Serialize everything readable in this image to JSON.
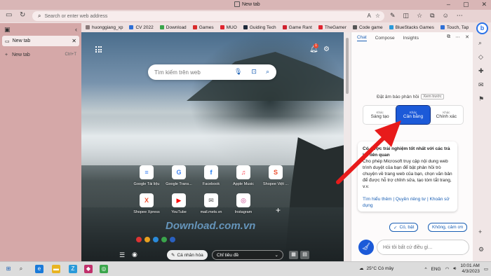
{
  "window": {
    "title": "New tab"
  },
  "address_bar": {
    "placeholder": "Search or enter web address"
  },
  "favorites": [
    {
      "label": "huonggiang_xp",
      "color": "#8a7b7b"
    },
    {
      "label": "CV 2022",
      "color": "#2f6fd6"
    },
    {
      "label": "Download",
      "color": "#3aa54b"
    },
    {
      "label": "Games",
      "color": "#d92b2b"
    },
    {
      "label": "MUO",
      "color": "#e0242f"
    },
    {
      "label": "Guiding Tech",
      "color": "#1e2a3a"
    },
    {
      "label": "Game Rant",
      "color": "#d0202d"
    },
    {
      "label": "TheGamer",
      "color": "#e0242f"
    },
    {
      "label": "Code game",
      "color": "#555555"
    },
    {
      "label": "BlueStacks Games",
      "color": "#2a9ad9"
    },
    {
      "label": "Touch, Tap",
      "color": "#2f6fd6"
    }
  ],
  "sidebar": {
    "active_tab": "New tab",
    "new_tab_label": "New tab",
    "new_tab_shortcut": "Ctrl+T"
  },
  "newtab": {
    "notification_count": "1",
    "search_placeholder": "Tìm kiếm trên web",
    "tiles": [
      {
        "label": "Google Tài liệu",
        "glyph": "≡",
        "color": "#4285f4"
      },
      {
        "label": "Google Trans...",
        "glyph": "G",
        "color": "#4285f4"
      },
      {
        "label": "Facebook",
        "glyph": "f",
        "color": "#1877f2"
      },
      {
        "label": "Apple Music",
        "glyph": "♫",
        "color": "#fa3c4c"
      },
      {
        "label": "Shopee Việt ...",
        "glyph": "S",
        "color": "#ee4d2d"
      },
      {
        "label": "Shopee Xpress",
        "glyph": "X",
        "color": "#ee4d2d"
      },
      {
        "label": "YouTube",
        "glyph": "▶",
        "color": "#ff0000"
      },
      {
        "label": "mail.mets.vn",
        "glyph": "✉",
        "color": "#5b5b5b"
      },
      {
        "label": "Instagram",
        "glyph": "◎",
        "color": "#c13584"
      }
    ],
    "watermark": "Download.com.vn",
    "personalize_label": "Cá nhân hóa",
    "headings_label": "Chỉ tiêu đề"
  },
  "chat_pane": {
    "tabs": [
      "Chat",
      "Compose",
      "Insights"
    ],
    "tone_label": "Đặt âm báo phản hồi",
    "preview_label": "Xem trước",
    "tones": [
      {
        "small": "Khác",
        "label": "Sáng tạo"
      },
      {
        "small": "Khác",
        "label": "Cân bằng"
      },
      {
        "small": "Khác",
        "label": "Chính xác"
      }
    ],
    "card_heading": "Có được trải nghiệm tốt nhất với các trả lời liên quan",
    "card_body": "Cho phép Microsoft truy cập nội dung web trình duyệt của bạn để bật phản hồi trò chuyện về trang web của bạn, chọn văn bản để được hỗ trợ chỉnh sửa, tạo tóm tắt trang, v.v.",
    "card_link1": "Tìm hiểu thêm",
    "card_link2": "Quyền riêng tư",
    "card_link3": "Khoản sử dụng",
    "yes_label": "Có, bật",
    "no_label": "Không, cảm ơn",
    "ask_placeholder": "Hỏi tôi bất cứ điều gì..."
  },
  "taskbar": {
    "weather": "25°C  Có mây",
    "language": "ENG",
    "time": "10:01 AM",
    "date": "4/3/2023"
  },
  "accent": "#1c5ad8"
}
